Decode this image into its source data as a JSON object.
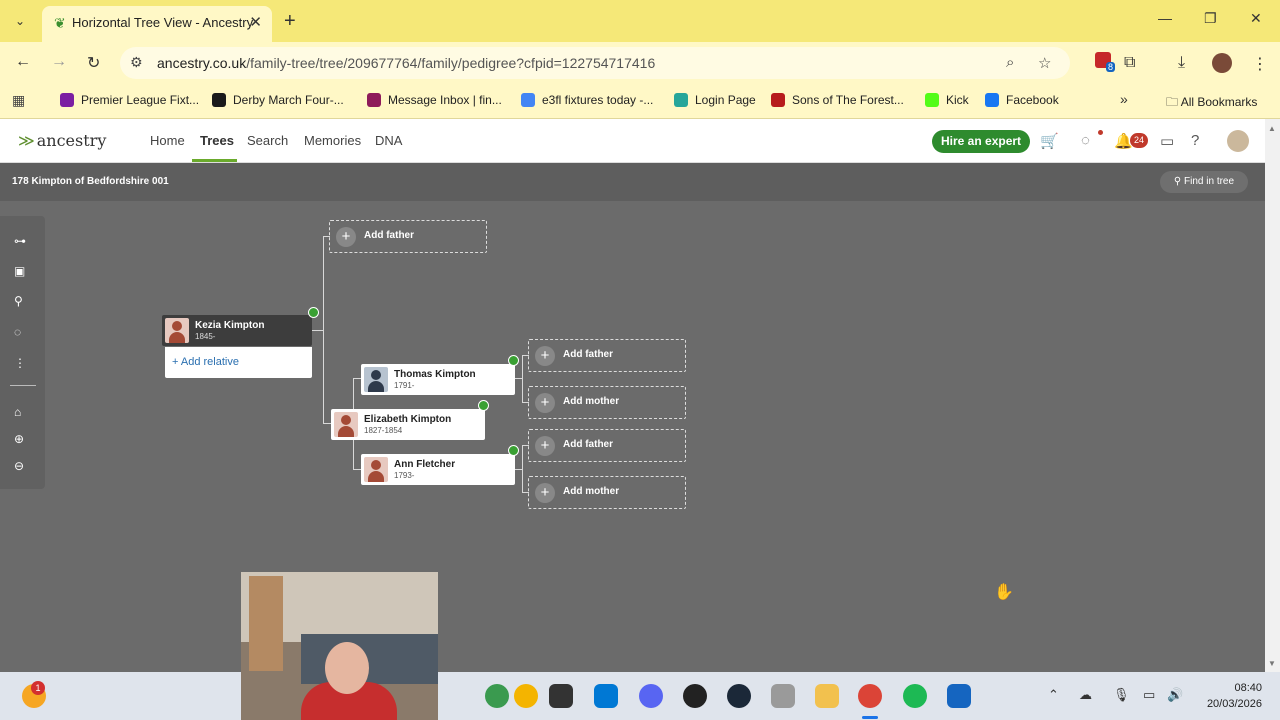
{
  "browser": {
    "tab_title": "Horizontal Tree View - Ancestry",
    "url_host": "ancestry.co.uk",
    "url_path": "/family-tree/tree/209677764/family/pedigree?cfpid=122754717416",
    "extension_badge": "8",
    "bookmarks": [
      {
        "label": "Premier League Fixt...",
        "color": "#7b1fa2"
      },
      {
        "label": "Derby March Four-...",
        "color": "#1a1a1a"
      },
      {
        "label": "Message Inbox | fin...",
        "color": "#8e1b5a"
      },
      {
        "label": "e3fl fixtures today -...",
        "color": "#4285f4"
      },
      {
        "label": "Login Page",
        "color": "#26a69a"
      },
      {
        "label": "Sons of The Forest...",
        "color": "#b71c1c"
      },
      {
        "label": "Kick",
        "color": "#53fc18"
      },
      {
        "label": "Facebook",
        "color": "#1877f2"
      }
    ],
    "all_bookmarks": "All Bookmarks"
  },
  "ancestry": {
    "logo": "ancestry",
    "nav": [
      "Home",
      "Trees",
      "Search",
      "Memories",
      "DNA"
    ],
    "active_nav": "Trees",
    "hire_button": "Hire an expert",
    "notification_count": "24",
    "tree_name": "178 Kimpton of Bedfordshire 001",
    "find_in_tree": "Find in tree"
  },
  "tree": {
    "focus_person": {
      "name": "Kezia Kimpton",
      "dates": "1845-"
    },
    "add_relative": "Add relative",
    "people": [
      {
        "name": "Thomas Kimpton",
        "dates": "1791-",
        "gender": "male"
      },
      {
        "name": "Elizabeth Kimpton",
        "dates": "1827-1854",
        "gender": "female"
      },
      {
        "name": "Ann Fletcher",
        "dates": "1793-",
        "gender": "female"
      }
    ],
    "empty_slots": [
      "Add father",
      "Add father",
      "Add mother",
      "Add father",
      "Add mother"
    ]
  },
  "taskbar": {
    "notification_badge": "1",
    "time": "08:40",
    "date": "20/03/2026"
  }
}
